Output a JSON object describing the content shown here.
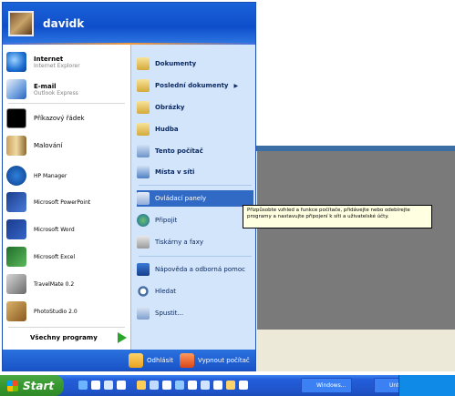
{
  "user": {
    "name": "davidk"
  },
  "pinned": [
    {
      "title": "Internet",
      "subtitle": "Internet Explorer",
      "icon": "internet-explorer-icon"
    },
    {
      "title": "E-mail",
      "subtitle": "Outlook Express",
      "icon": "email-icon"
    }
  ],
  "recent": [
    {
      "label": "Příkazový řádek",
      "icon": "command-prompt-icon"
    },
    {
      "label": "Malování",
      "icon": "paint-icon"
    },
    {
      "label": "HP Manager",
      "icon": "hp-manager-icon"
    },
    {
      "label": "Microsoft PowerPoint",
      "icon": "powerpoint-icon"
    },
    {
      "label": "Microsoft Word",
      "icon": "word-icon"
    },
    {
      "label": "Microsoft Excel",
      "icon": "excel-icon"
    },
    {
      "label": "TravelMate 0.2",
      "icon": "travelmate-icon"
    },
    {
      "label": "PhotoStudio 2.0",
      "icon": "photostudio-icon"
    }
  ],
  "all_programs": "Všechny programy",
  "places": [
    {
      "label": "Dokumenty",
      "bold": true,
      "icon": "documents-folder-icon"
    },
    {
      "label": "Poslední dokumenty",
      "bold": true,
      "icon": "recent-documents-icon"
    },
    {
      "label": "Obrázky",
      "bold": true,
      "icon": "pictures-folder-icon"
    },
    {
      "label": "Hudba",
      "bold": true,
      "icon": "music-folder-icon"
    },
    {
      "label": "Tento počítač",
      "bold": true,
      "icon": "my-computer-icon"
    },
    {
      "label": "Místa v síti",
      "bold": true,
      "icon": "network-places-icon"
    },
    {
      "label": "Ovládací panely",
      "bold": false,
      "icon": "control-panel-icon"
    },
    {
      "label": "Připojit",
      "bold": false,
      "icon": "connect-icon"
    },
    {
      "label": "Tiskárny a faxy",
      "bold": false,
      "icon": "printers-icon"
    },
    {
      "label": "Nápověda a odborná pomoc",
      "bold": false,
      "icon": "help-icon"
    },
    {
      "label": "Hledat",
      "bold": false,
      "icon": "search-icon"
    },
    {
      "label": "Spustit...",
      "bold": false,
      "icon": "run-icon"
    }
  ],
  "tooltip": "Přizpůsobte vzhled a funkce počítače, přidávejte nebo odebírejte programy a nastavujte připojení k síti a uživatelské účty.",
  "footer": {
    "logoff": "Odhlásit",
    "shutdown": "Vypnout počítač"
  },
  "taskbar": {
    "start": "Start",
    "buttons": [
      "Windows...",
      "Untitl..."
    ]
  },
  "colors": {
    "start_green": "#37982f",
    "xp_blue": "#1f53c8",
    "selection": "#316ac5",
    "tooltip_bg": "#ffffe1"
  }
}
